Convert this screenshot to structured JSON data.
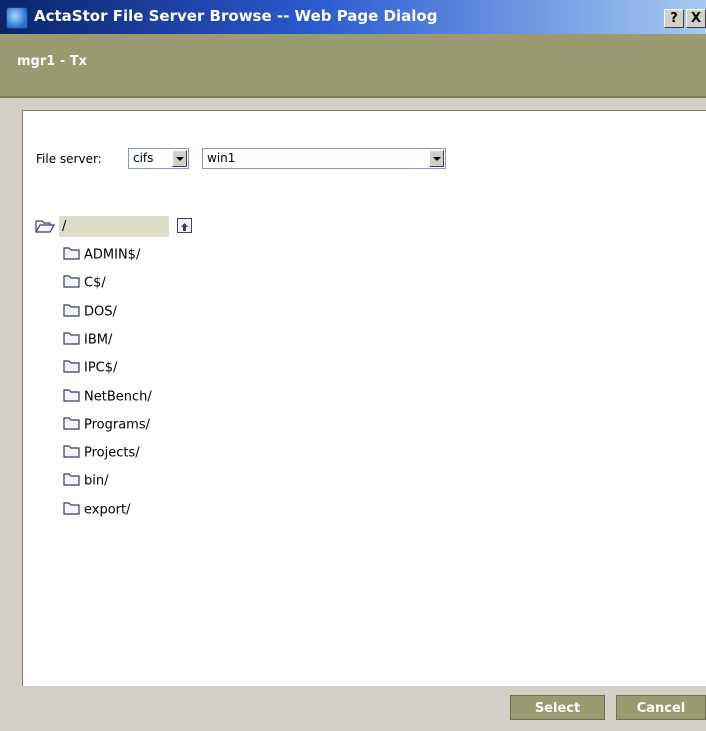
{
  "window": {
    "title": "ActaStor File Server Browse -- Web Page Dialog",
    "help_label": "?",
    "close_label": "X"
  },
  "header": {
    "subtitle": "mgr1 - Tx"
  },
  "form": {
    "file_server_label": "File server:",
    "protocol_value": "cifs",
    "server_value": "win1"
  },
  "tree": {
    "root_label": "/",
    "items": [
      {
        "label": "ADMIN$/"
      },
      {
        "label": "C$/"
      },
      {
        "label": "DOS/"
      },
      {
        "label": "IBM/"
      },
      {
        "label": "IPC$/"
      },
      {
        "label": "NetBench/"
      },
      {
        "label": "Programs/"
      },
      {
        "label": "Projects/"
      },
      {
        "label": "bin/"
      },
      {
        "label": "export/"
      }
    ]
  },
  "buttons": {
    "select": "Select",
    "cancel": "Cancel"
  },
  "colors": {
    "accent": "#9b9b71",
    "titlebar_start": "#0a246a",
    "titlebar_end": "#a6caf0",
    "root_highlight": "#dedec8"
  }
}
